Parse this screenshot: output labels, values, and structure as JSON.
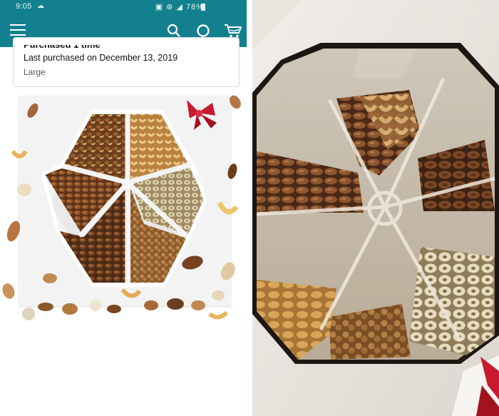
{
  "status_bar": {
    "time": "9:05",
    "battery": "78%"
  },
  "app_bar": {
    "icons": [
      "menu-icon",
      "search-icon",
      "alexa-icon",
      "cart-icon"
    ],
    "background": "#12808f"
  },
  "purchase_card": {
    "heading": "Purchased 1 time",
    "last_purchased": "Last purchased on December 13, 2019",
    "size": "Large"
  },
  "colors": {
    "header": "#12808f",
    "ribbon": "#c8192e",
    "tray": "#d9d6cf"
  }
}
